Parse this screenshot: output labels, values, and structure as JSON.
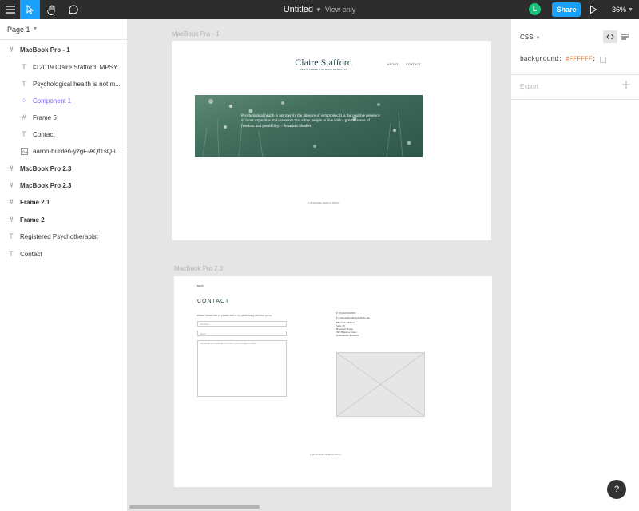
{
  "toolbar": {
    "doc_name": "Untitled",
    "doc_mode": "View only",
    "avatar_initial": "L",
    "share_label": "Share",
    "zoom": "36%"
  },
  "sidebar": {
    "page": "Page 1",
    "layers": [
      {
        "label": "MacBook Pro - 1",
        "icon": "frame-icon"
      },
      {
        "label": "© 2019 Claire Stafford, MPSY.",
        "icon": "text-icon"
      },
      {
        "label": "Psychological health is not m...",
        "icon": "text-icon"
      },
      {
        "label": "Component 1",
        "icon": "component-icon"
      },
      {
        "label": "Frame 5",
        "icon": "frame-icon"
      },
      {
        "label": "Contact",
        "icon": "text-icon"
      },
      {
        "label": "aaron-burden-yzgF-AQt1sQ-u...",
        "icon": "image-icon"
      },
      {
        "label": "MacBook Pro 2.3",
        "icon": "frame-icon"
      },
      {
        "label": "MacBook Pro 2.3",
        "icon": "frame-icon"
      },
      {
        "label": "Frame 2.1",
        "icon": "frame-icon"
      },
      {
        "label": "Frame 2",
        "icon": "frame-icon"
      },
      {
        "label": "Registered Psychotherapist",
        "icon": "text-icon"
      },
      {
        "label": "Contact",
        "icon": "text-icon"
      }
    ]
  },
  "canvas": {
    "frame1": {
      "label": "MacBook Pro - 1",
      "logo": "Claire Stafford",
      "logo_sub": "REGISTERED PSYCHOTHERAPIST",
      "nav": [
        "ABOUT",
        "CONTACT"
      ],
      "quote": "Psychological health is not merely the absence of symptoms; it is the positive presence of inner capacities and resources that allow people to live with a greater sense of freedom and possibility. – Jonathan Shedler",
      "footer": "© 2019 Claire Stafford, MPSY."
    },
    "frame2": {
      "label": "MacBook Pro 2.3",
      "back": "BACK",
      "heading": "CONTACT",
      "intro": "Please contact me by phone, text or by email using the form below",
      "name_placeholder": "Full Name",
      "email_placeholder": "Email",
      "message_placeholder": "Any details you would like to include in your message to Claire",
      "phone": "P: (64)0225240952",
      "email": "E: clairestafford029@gmail.com",
      "address_title": "Physical Address",
      "address_lines": [
        "Suite 3E",
        "Hawstein House",
        "393 Hinemoa Street",
        "Birkenhead, Auckland"
      ],
      "footer": "© 2019 Claire Stafford, MPSY."
    }
  },
  "inspector": {
    "mode": "CSS",
    "property": "background:",
    "value": "#FFFFFF",
    "export_label": "Export"
  },
  "help_label": "?"
}
